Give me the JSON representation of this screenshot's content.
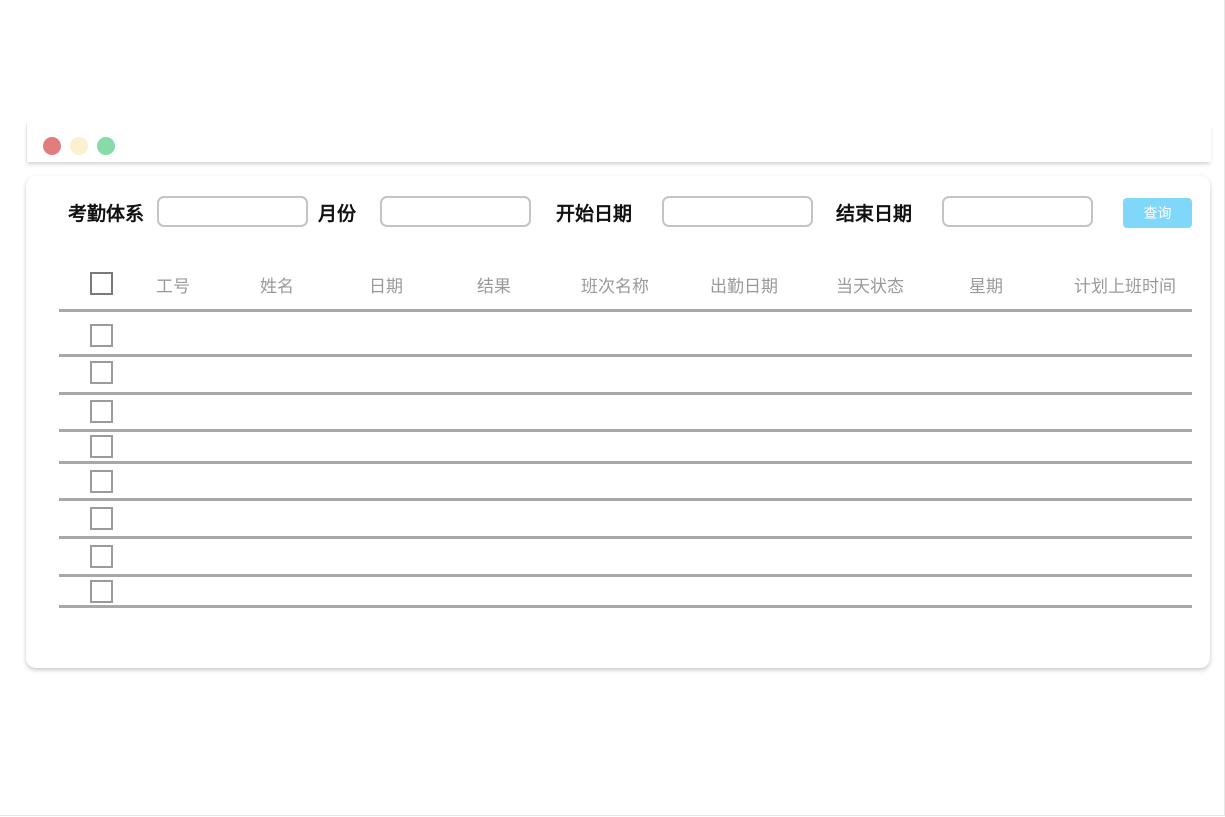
{
  "window": {
    "controls": [
      {
        "name": "close",
        "color": "#e27d7f"
      },
      {
        "name": "minimize",
        "color": "#fbf0cf"
      },
      {
        "name": "maximize",
        "color": "#86dba9"
      }
    ]
  },
  "filters": {
    "attendance_system_label": "考勤体系",
    "attendance_system_value": "",
    "month_label": "月份",
    "month_value": "",
    "start_date_label": "开始日期",
    "start_date_value": "",
    "end_date_label": "结束日期",
    "end_date_value": "",
    "query_button": "查询",
    "query_button_color": "#7fd8f9"
  },
  "table": {
    "columns": [
      "工号",
      "姓名",
      "日期",
      "结果",
      "班次名称",
      "出勤日期",
      "当天状态",
      "星期",
      "计划上班时间"
    ],
    "rows": [
      {
        "checked": false
      },
      {
        "checked": false
      },
      {
        "checked": false
      },
      {
        "checked": false
      },
      {
        "checked": false
      },
      {
        "checked": false
      },
      {
        "checked": false
      },
      {
        "checked": false
      }
    ]
  }
}
